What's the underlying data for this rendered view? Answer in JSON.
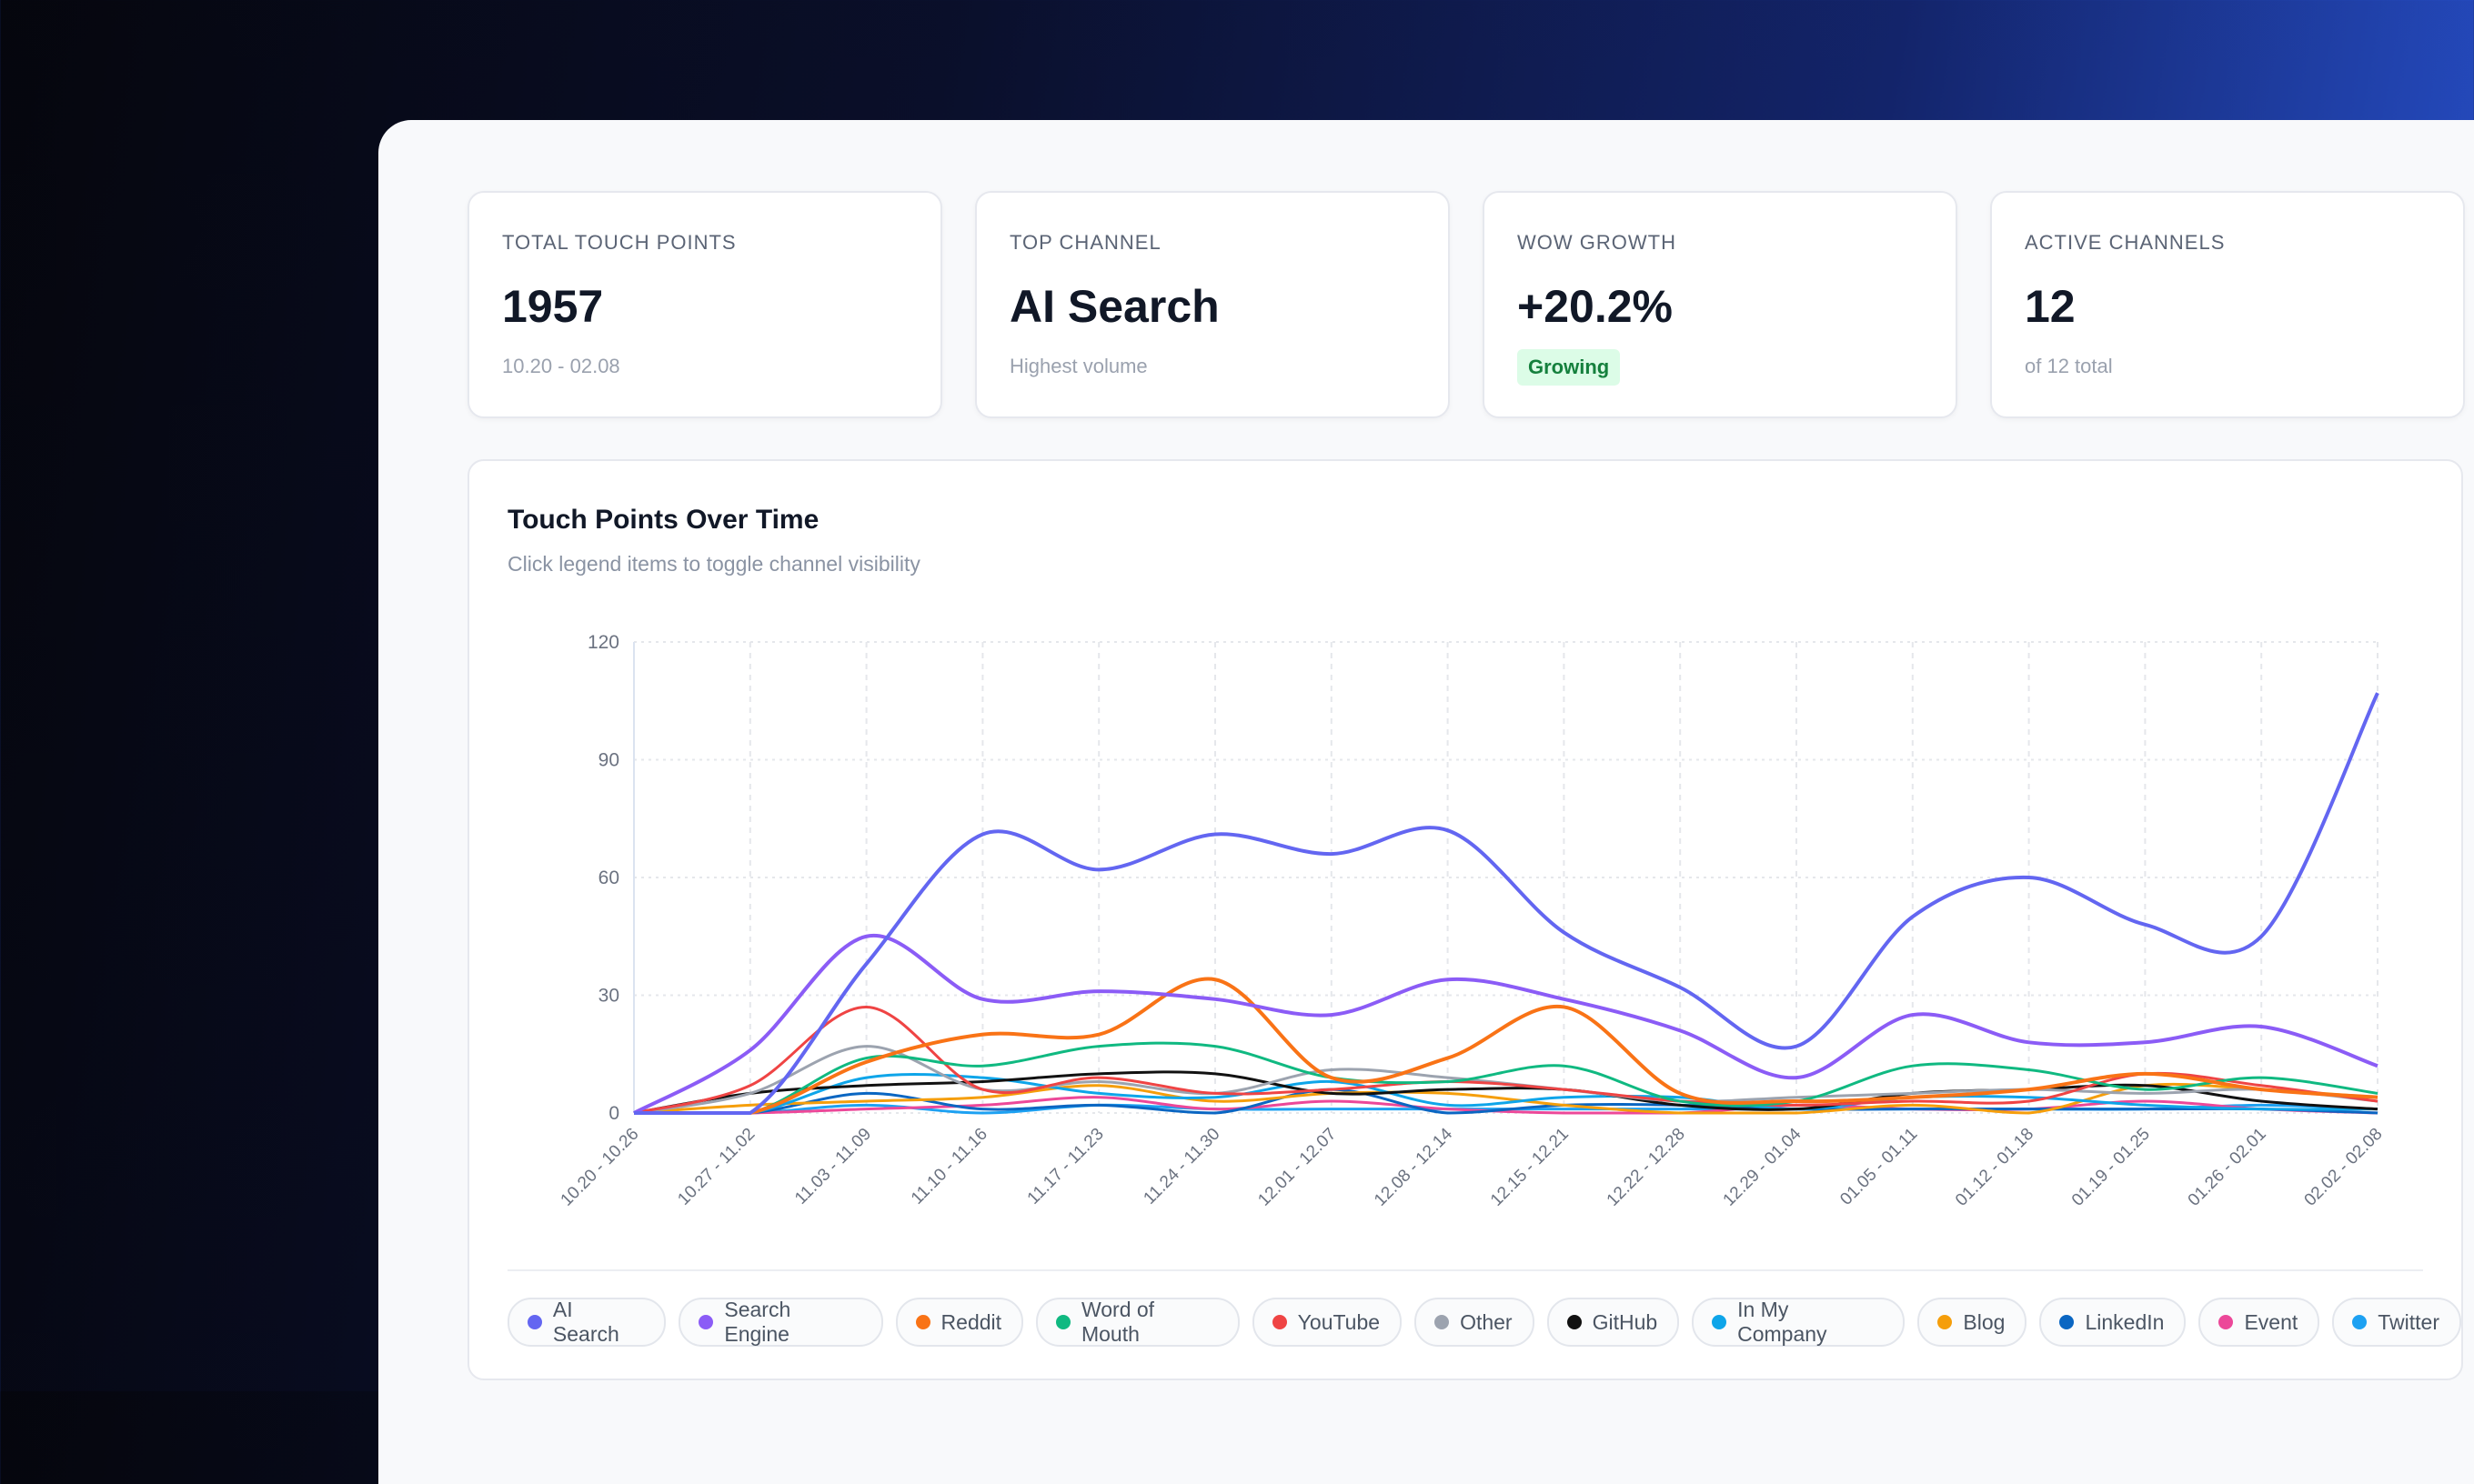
{
  "cards": [
    {
      "label": "Total Touch Points",
      "value": "1957",
      "sub": "10.20 - 02.08"
    },
    {
      "label": "Top Channel",
      "value": "AI Search",
      "sub": "Highest volume"
    },
    {
      "label": "WoW Growth",
      "value": "+20.2%",
      "badge": "Growing"
    },
    {
      "label": "Active Channels",
      "value": "12",
      "sub": "of 12 total"
    }
  ],
  "chart": {
    "title": "Touch Points Over Time",
    "subtitle": "Click legend items to toggle channel visibility"
  },
  "chart_data": {
    "type": "line",
    "title": "Touch Points Over Time",
    "xlabel": "",
    "ylabel": "",
    "ylim": [
      0,
      120
    ],
    "yticks": [
      0,
      30,
      60,
      90,
      120
    ],
    "grid": true,
    "legend": "bottom",
    "categories": [
      "10.20 - 10.26",
      "10.27 - 11.02",
      "11.03 - 11.09",
      "11.10 - 11.16",
      "11.17 - 11.23",
      "11.24 - 11.30",
      "12.01 - 12.07",
      "12.08 - 12.14",
      "12.15 - 12.21",
      "12.22 - 12.28",
      "12.29 - 01.04",
      "01.05 - 01.11",
      "01.12 - 01.18",
      "01.19 - 01.25",
      "01.26 - 02.01",
      "02.02 - 02.08"
    ],
    "series": [
      {
        "name": "AI Search",
        "color": "#6366f1",
        "width": 4,
        "values": [
          0,
          0,
          38,
          71,
          62,
          71,
          66,
          72,
          46,
          32,
          17,
          50,
          60,
          48,
          45,
          107
        ]
      },
      {
        "name": "Search Engine",
        "color": "#8b5cf6",
        "width": 4,
        "values": [
          0,
          16,
          45,
          29,
          31,
          29,
          25,
          34,
          29,
          21,
          9,
          25,
          18,
          18,
          22,
          12
        ]
      },
      {
        "name": "Reddit",
        "color": "#f97316",
        "width": 4,
        "values": [
          0,
          0,
          13,
          20,
          20,
          34,
          9,
          14,
          27,
          5,
          3,
          4,
          6,
          10,
          6,
          4
        ]
      },
      {
        "name": "Word of Mouth",
        "color": "#10b981",
        "width": 3,
        "values": [
          0,
          0,
          14,
          12,
          17,
          17,
          9,
          8,
          12,
          3,
          3,
          12,
          11,
          6,
          9,
          5
        ]
      },
      {
        "name": "YouTube",
        "color": "#ef4444",
        "width": 3,
        "values": [
          0,
          7,
          27,
          6,
          9,
          5,
          6,
          8,
          6,
          3,
          2,
          3,
          3,
          10,
          7,
          3
        ]
      },
      {
        "name": "Other",
        "color": "#9ca3af",
        "width": 3,
        "values": [
          0,
          5,
          17,
          6,
          8,
          5,
          11,
          9,
          6,
          3,
          4,
          5,
          6,
          5,
          6,
          3
        ]
      },
      {
        "name": "GitHub",
        "color": "#111111",
        "width": 3,
        "values": [
          0,
          5,
          7,
          8,
          10,
          10,
          5,
          6,
          6,
          2,
          1,
          5,
          6,
          7,
          3,
          1
        ]
      },
      {
        "name": "In My Company",
        "color": "#0ea5e9",
        "width": 3,
        "values": [
          0,
          0,
          9,
          9,
          5,
          4,
          8,
          2,
          4,
          4,
          1,
          4,
          4,
          2,
          1,
          1
        ]
      },
      {
        "name": "Blog",
        "color": "#f59e0b",
        "width": 3,
        "values": [
          0,
          2,
          3,
          4,
          7,
          3,
          5,
          5,
          2,
          0,
          0,
          2,
          0,
          7,
          6,
          4
        ]
      },
      {
        "name": "LinkedIn",
        "color": "#0a66c2",
        "width": 3,
        "values": [
          0,
          0,
          5,
          1,
          2,
          0,
          6,
          0,
          2,
          2,
          1,
          1,
          1,
          1,
          1,
          0
        ]
      },
      {
        "name": "Event",
        "color": "#ec4899",
        "width": 3,
        "values": [
          0,
          0,
          1,
          2,
          4,
          1,
          3,
          1,
          0,
          0,
          2,
          1,
          1,
          3,
          1,
          0
        ]
      },
      {
        "name": "Twitter",
        "color": "#1da1f2",
        "width": 3,
        "values": [
          0,
          0,
          2,
          0,
          2,
          1,
          1,
          1,
          1,
          1,
          1,
          1,
          1,
          1,
          2,
          1
        ]
      }
    ]
  }
}
